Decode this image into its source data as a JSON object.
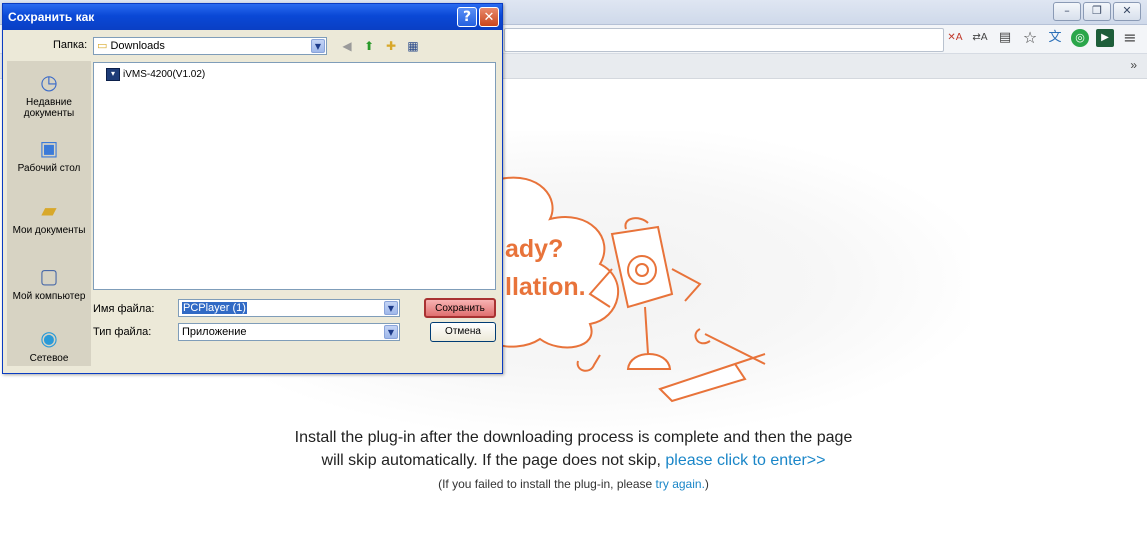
{
  "browser": {
    "window_controls": [
      "–",
      "❐",
      "✕"
    ],
    "bookmarks_more": "»",
    "toolbar_icons": [
      {
        "name": "translate-disabled-icon",
        "glyph": "✕A"
      },
      {
        "name": "translate-icon",
        "glyph": "⇄A"
      },
      {
        "name": "extension-icon",
        "glyph": "▤"
      },
      {
        "name": "bookmark-star-icon",
        "glyph": "☆"
      },
      {
        "name": "translator-extension-icon",
        "glyph": "文"
      },
      {
        "name": "green-extension-icon",
        "glyph": "◎"
      },
      {
        "name": "dark-extension-icon",
        "glyph": "▶"
      },
      {
        "name": "menu-icon",
        "glyph": "≡"
      }
    ]
  },
  "page": {
    "headline_1": "ady?",
    "headline_2": "llation.",
    "message_line_1": "Install the plug-in after the downloading process is complete and then the page",
    "message_line_2_prefix": "will skip automatically. If the page does not skip, ",
    "message_line_2_link": "please click to enter>>",
    "message_line_3_prefix": "(If you failed to install the plug-in, please ",
    "message_line_3_link": "try again.",
    "message_line_3_suffix": ")",
    "accent_color": "#e8733a",
    "link_color": "#1a86c8"
  },
  "dialog": {
    "title": "Сохранить как",
    "help_button": "?",
    "close_button": "✕",
    "folder_label": "Папка:",
    "folder_value": "Downloads",
    "places": [
      {
        "label": "Недавние документы"
      },
      {
        "label": "Рабочий стол"
      },
      {
        "label": "Мои документы"
      },
      {
        "label": "Мой компьютер"
      },
      {
        "label": "Сетевое"
      }
    ],
    "files": [
      {
        "name": "iVMS-4200(V1.02)"
      }
    ],
    "filename_label": "Имя файла:",
    "filename_value": "PCPlayer (1)",
    "filetype_label": "Тип файла:",
    "filetype_value": "Приложение",
    "save_button": "Сохранить",
    "cancel_button": "Отмена"
  }
}
